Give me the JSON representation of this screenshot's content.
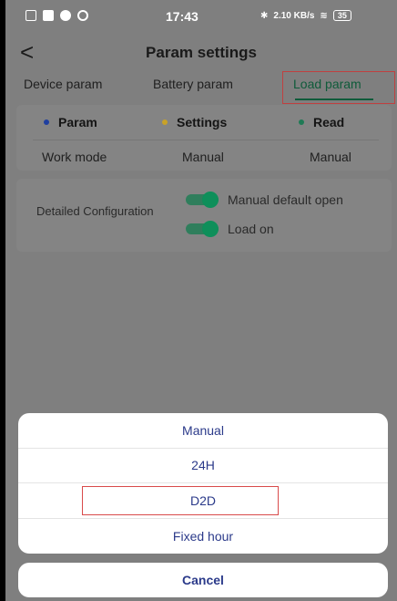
{
  "status_bar": {
    "time": "17:43",
    "network_speed": "2.10 KB/s",
    "battery_level": "35",
    "icons": [
      "sim-icon",
      "message-icon",
      "record-icon",
      "sync-icon",
      "bluetooth-icon",
      "wifi-icon",
      "battery-icon"
    ]
  },
  "header": {
    "back_glyph": "<",
    "title": "Param settings"
  },
  "tabs": [
    {
      "label": "Device param",
      "active": false
    },
    {
      "label": "Battery param",
      "active": false
    },
    {
      "label": "Load param",
      "active": true
    }
  ],
  "param_table": {
    "columns": [
      {
        "label": "Param",
        "dot_color": "#1f3f9f"
      },
      {
        "label": "Settings",
        "dot_color": "#c9a227"
      },
      {
        "label": "Read",
        "dot_color": "#1f7a55"
      }
    ],
    "rows": [
      {
        "param": "Work mode",
        "setting": "Manual",
        "read": "Manual"
      }
    ]
  },
  "detailed_configuration": {
    "label": "Detailed Configuration",
    "toggles": [
      {
        "label": "Manual default open",
        "on": true
      },
      {
        "label": "Load on",
        "on": true
      }
    ]
  },
  "action_sheet": {
    "options": [
      "Manual",
      "24H",
      "D2D",
      "Fixed hour"
    ],
    "highlighted_option": "D2D",
    "cancel_label": "Cancel"
  },
  "colors": {
    "accent_green": "#0f5b3a",
    "toggle_green": "#0e8f5a",
    "sheet_text": "#2b3a8a",
    "highlight_red": "#d94a4a"
  }
}
